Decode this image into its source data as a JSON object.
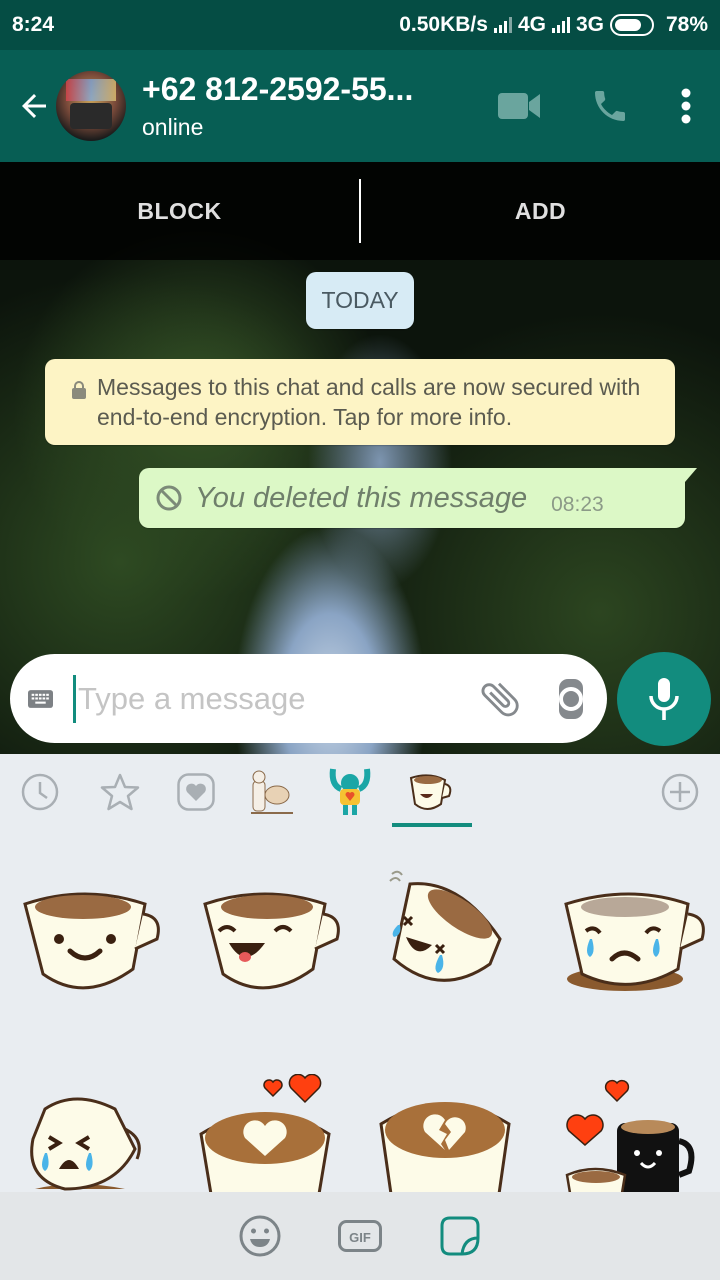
{
  "status_bar": {
    "time": "8:24",
    "network_speed": "0.50KB/s",
    "network_1": "4G",
    "network_2": "3G",
    "battery_percent": "78%",
    "battery_level": 0.78
  },
  "app_bar": {
    "contact_name": "+62 812-2592-55...",
    "contact_status": "online",
    "icons": [
      "back-arrow-icon",
      "avatar",
      "video-call-icon",
      "voice-call-icon",
      "more-options-icon"
    ]
  },
  "action_bar": {
    "block_label": "BLOCK",
    "add_label": "ADD"
  },
  "chat": {
    "date_chip": "TODAY",
    "encryption_notice": "Messages to this chat and calls are now secured with end-to-end encryption. Tap for more info.",
    "messages": [
      {
        "type": "outgoing",
        "text": "You deleted this message",
        "time": "08:23",
        "deleted": true
      }
    ]
  },
  "composer": {
    "placeholder": "Type a message",
    "value": ""
  },
  "sticker_tray": {
    "tabs": [
      {
        "name": "recent",
        "icon": "clock-icon"
      },
      {
        "name": "starred",
        "icon": "star-icon"
      },
      {
        "name": "favorites",
        "icon": "heart-icon"
      },
      {
        "name": "dog-pack",
        "icon": "dog-sticker-icon"
      },
      {
        "name": "monkey-pack",
        "icon": "monkey-sticker-icon"
      },
      {
        "name": "coffee-pack",
        "icon": "coffee-cup-sticker-icon",
        "selected": true
      },
      {
        "name": "add",
        "icon": "add-icon"
      }
    ],
    "stickers": [
      "coffee-smile",
      "coffee-laugh",
      "coffee-falling-tears",
      "coffee-sad-spill",
      "coffee-crying-tipped",
      "latte-heart",
      "latte-broken-heart",
      "mugs-in-love"
    ]
  },
  "bottom_bar": {
    "tabs": [
      "emoji",
      "gif",
      "sticker"
    ],
    "gif_label": "GIF",
    "selected": "sticker"
  },
  "colors": {
    "status_bar": "#054d44",
    "app_bar": "#075e54",
    "accent": "#128c7e",
    "outgoing_bubble": "#dcf8c6",
    "notice_bubble": "#fdf4c5",
    "date_chip": "#d7ebf5"
  }
}
